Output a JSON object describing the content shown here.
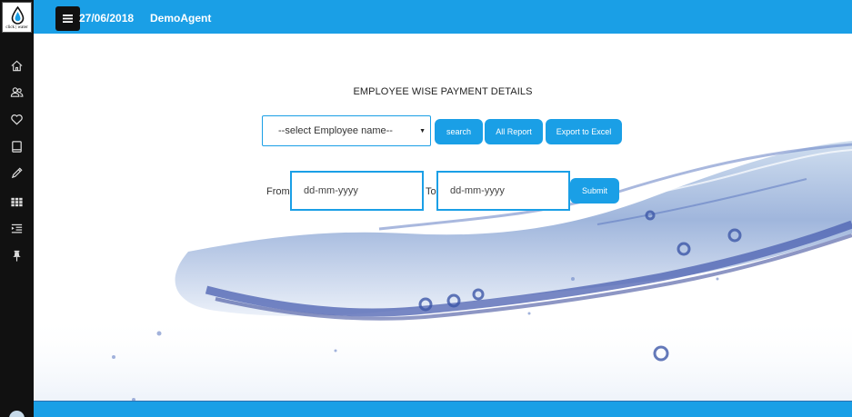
{
  "brand": {
    "logo_text": "click | water"
  },
  "header": {
    "date": "27/06/2018",
    "agent": "DemoAgent"
  },
  "sidebar": {
    "icons": [
      "home-icon",
      "users-icon",
      "heart-icon",
      "book-icon",
      "pencil-icon",
      "grid-icon",
      "indent-icon",
      "pin-icon"
    ]
  },
  "page": {
    "title": "EMPLOYEE WISE PAYMENT DETAILS",
    "employee_select": {
      "value": "--select Employee name--"
    },
    "buttons": {
      "search": "search",
      "all_report": "All Report",
      "export": "Export to Excel",
      "submit": "Submit"
    },
    "date_range": {
      "from_label": "From",
      "to_label": "To",
      "from_placeholder": "dd-mm-yyyy",
      "to_placeholder": "dd-mm-yyyy"
    }
  },
  "colors": {
    "accent": "#1a9fe6",
    "sidebar": "#111111"
  }
}
